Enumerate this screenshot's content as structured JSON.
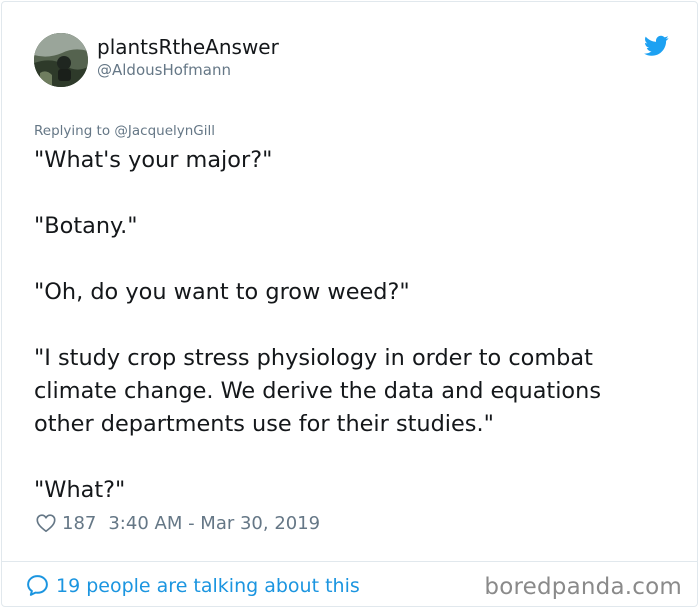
{
  "author": {
    "display_name": "plantsRtheAnswer",
    "handle": "@AldousHofmann",
    "avatar_icon": "profile-photo"
  },
  "reply": {
    "text": "Replying to @JacquelynGill"
  },
  "tweet": {
    "paragraphs": [
      "\"What's your major?\"",
      "\"Botany.\"",
      "\"Oh, do you want to grow weed?\"",
      "\"I study crop stress physiology in order to combat\nclimate change.  We derive the data and equations\nother departments use for their studies.\"",
      "\"What?\""
    ]
  },
  "meta": {
    "likes": "187",
    "timestamp": "3:40 AM - Mar 30, 2019"
  },
  "footer": {
    "talking_text": "19 people are talking about this",
    "watermark": "boredpanda.com"
  },
  "colors": {
    "twitter_blue": "#1da1f2",
    "link_blue": "#1b95e0",
    "secondary_text": "#657786",
    "primary_text": "#14171a"
  }
}
